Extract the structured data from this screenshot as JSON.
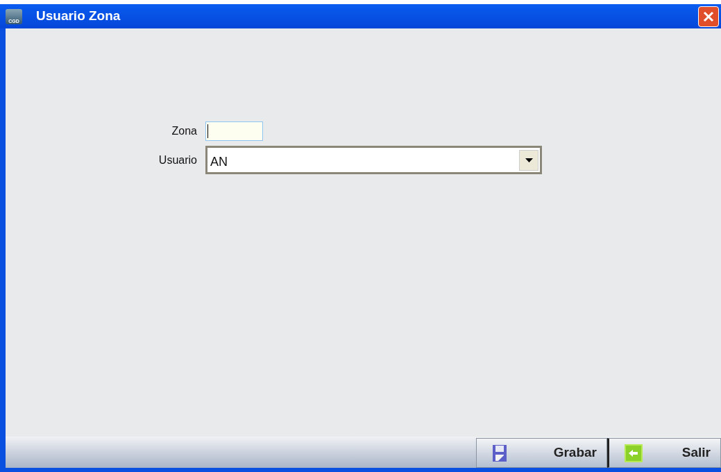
{
  "window": {
    "title": "Usuario Zona",
    "app_icon_text": "CGD"
  },
  "form": {
    "fields": [
      {
        "kind": "text",
        "label": "Zona",
        "focused": true
      },
      {
        "kind": "combo",
        "label": "Usuario",
        "value": "AN"
      }
    ]
  },
  "buttons": [
    {
      "kind": "save",
      "label": "Grabar"
    },
    {
      "kind": "exit",
      "label": "Salir"
    }
  ]
}
